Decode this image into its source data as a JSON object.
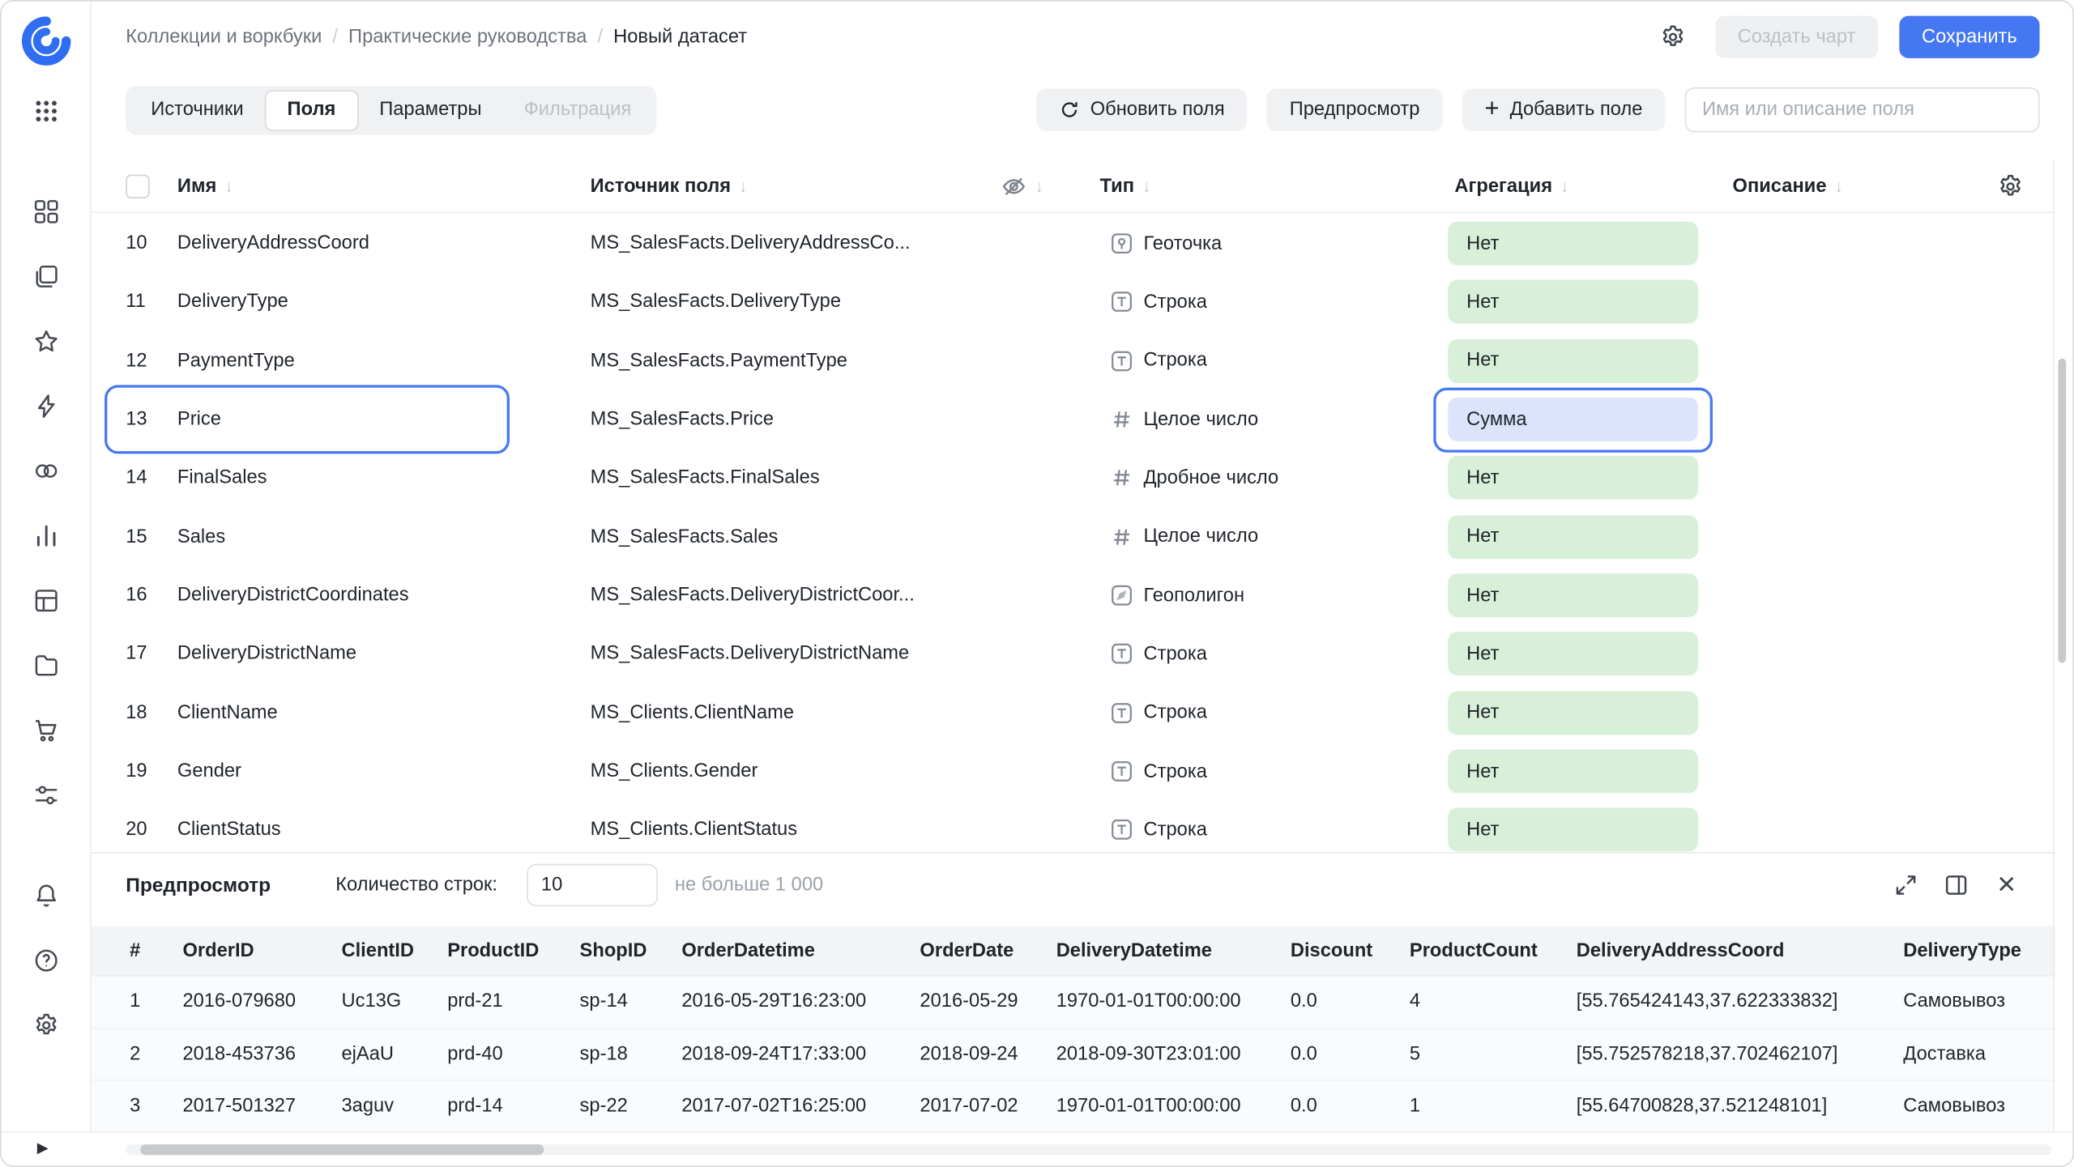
{
  "colors": {
    "accent_blue": "#4577f2",
    "badge_green_bg": "#d8f0d8",
    "badge_selected_bg": "#dbe4fb",
    "selection_outline": "#4678f2"
  },
  "icons": {
    "plus": "+",
    "sort_down": "↓",
    "close": "×",
    "collapse": "▶",
    "breadcrumb_separator": "/"
  },
  "sidebar": {
    "items": [
      "logo",
      "apps-grid",
      "dashboards",
      "workbooks",
      "favorites",
      "connections",
      "datasets",
      "charts",
      "tables",
      "storage",
      "marketplace",
      "services",
      "notifications",
      "help",
      "settings",
      "collapse"
    ]
  },
  "topbar": {
    "breadcrumb": [
      "Коллекции и воркбуки",
      "Практические руководства",
      "Новый датасет"
    ],
    "create_chart_label": "Создать чарт",
    "save_label": "Сохранить"
  },
  "toolbar": {
    "tabs": [
      {
        "label": "Источники",
        "state": "normal"
      },
      {
        "label": "Поля",
        "state": "active"
      },
      {
        "label": "Параметры",
        "state": "normal"
      },
      {
        "label": "Фильтрация",
        "state": "disabled"
      }
    ],
    "refresh_label": "Обновить поля",
    "preview_label": "Предпросмотр",
    "add_field_label": "Добавить поле",
    "search_placeholder": "Имя или описание поля"
  },
  "fields_table": {
    "headers": {
      "name": "Имя",
      "source": "Источник поля",
      "type": "Тип",
      "aggregation": "Агрегация",
      "description": "Описание"
    },
    "rows": [
      {
        "num": "10",
        "name": "DeliveryAddressCoord",
        "source": "MS_SalesFacts.DeliveryAddressCo...",
        "type": "Геоточка",
        "type_icon": "geopoint",
        "aggregation": "Нет",
        "selected": false
      },
      {
        "num": "11",
        "name": "DeliveryType",
        "source": "MS_SalesFacts.DeliveryType",
        "type": "Строка",
        "type_icon": "string",
        "aggregation": "Нет",
        "selected": false
      },
      {
        "num": "12",
        "name": "PaymentType",
        "source": "MS_SalesFacts.PaymentType",
        "type": "Строка",
        "type_icon": "string",
        "aggregation": "Нет",
        "selected": false
      },
      {
        "num": "13",
        "name": "Price",
        "source": "MS_SalesFacts.Price",
        "type": "Целое число",
        "type_icon": "number",
        "aggregation": "Сумма",
        "selected": true
      },
      {
        "num": "14",
        "name": "FinalSales",
        "source": "MS_SalesFacts.FinalSales",
        "type": "Дробное число",
        "type_icon": "number",
        "aggregation": "Нет",
        "selected": false
      },
      {
        "num": "15",
        "name": "Sales",
        "source": "MS_SalesFacts.Sales",
        "type": "Целое число",
        "type_icon": "number",
        "aggregation": "Нет",
        "selected": false
      },
      {
        "num": "16",
        "name": "DeliveryDistrictCoordinates",
        "source": "MS_SalesFacts.DeliveryDistrictCoor...",
        "type": "Геополигон",
        "type_icon": "geopolygon",
        "aggregation": "Нет",
        "selected": false
      },
      {
        "num": "17",
        "name": "DeliveryDistrictName",
        "source": "MS_SalesFacts.DeliveryDistrictName",
        "type": "Строка",
        "type_icon": "string",
        "aggregation": "Нет",
        "selected": false
      },
      {
        "num": "18",
        "name": "ClientName",
        "source": "MS_Clients.ClientName",
        "type": "Строка",
        "type_icon": "string",
        "aggregation": "Нет",
        "selected": false
      },
      {
        "num": "19",
        "name": "Gender",
        "source": "MS_Clients.Gender",
        "type": "Строка",
        "type_icon": "string",
        "aggregation": "Нет",
        "selected": false
      },
      {
        "num": "20",
        "name": "ClientStatus",
        "source": "MS_Clients.ClientStatus",
        "type": "Строка",
        "type_icon": "string",
        "aggregation": "Нет",
        "selected": false
      }
    ]
  },
  "preview": {
    "title": "Предпросмотр",
    "row_count_label": "Количество строк:",
    "row_count_value": "10",
    "hint": "не больше 1 000",
    "columns": [
      "#",
      "OrderID",
      "ClientID",
      "ProductID",
      "ShopID",
      "OrderDatetime",
      "OrderDate",
      "DeliveryDatetime",
      "Discount",
      "ProductCount",
      "DeliveryAddressCoord",
      "DeliveryType"
    ],
    "rows": [
      [
        "1",
        "2016-079680",
        "Uc13G",
        "prd-21",
        "sp-14",
        "2016-05-29T16:23:00",
        "2016-05-29",
        "1970-01-01T00:00:00",
        "0.0",
        "4",
        "[55.765424143,37.622333832]",
        "Самовывоз"
      ],
      [
        "2",
        "2018-453736",
        "ejAaU",
        "prd-40",
        "sp-18",
        "2018-09-24T17:33:00",
        "2018-09-24",
        "2018-09-30T23:01:00",
        "0.0",
        "5",
        "[55.752578218,37.702462107]",
        "Доставка"
      ],
      [
        "3",
        "2017-501327",
        "3aguv",
        "prd-14",
        "sp-22",
        "2017-07-02T16:25:00",
        "2017-07-02",
        "1970-01-01T00:00:00",
        "0.0",
        "1",
        "[55.64700828,37.521248101]",
        "Самовывоз"
      ]
    ]
  }
}
